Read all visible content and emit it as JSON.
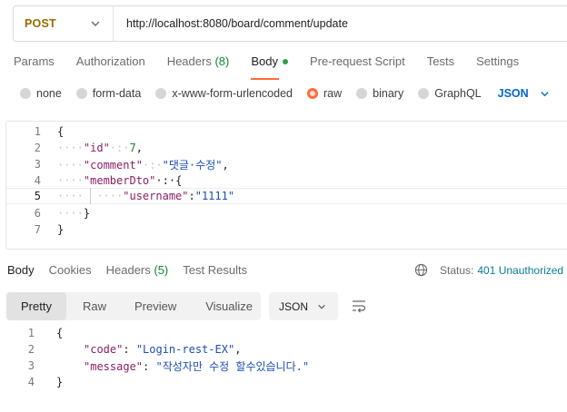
{
  "request": {
    "method": "POST",
    "url": "http://localhost:8080/board/comment/update"
  },
  "request_tabs": [
    {
      "label": "Params",
      "count": ""
    },
    {
      "label": "Authorization",
      "count": ""
    },
    {
      "label": "Headers",
      "count": "(8)"
    },
    {
      "label": "Body",
      "count": ""
    },
    {
      "label": "Pre-request Script",
      "count": ""
    },
    {
      "label": "Tests",
      "count": ""
    },
    {
      "label": "Settings",
      "count": ""
    }
  ],
  "body_types": [
    "none",
    "form-data",
    "x-www-form-urlencoded",
    "raw",
    "binary",
    "GraphQL"
  ],
  "body_language": "JSON",
  "request_body": {
    "line_numbers": [
      "1",
      "2",
      "3",
      "4",
      "5",
      "6",
      "7"
    ],
    "lines": [
      {
        "ws": "",
        "key": "",
        "rest": "{"
      },
      {
        "ws": "····",
        "key": "\"id\"",
        "rest": "·:·",
        "val": "7",
        "tail": ","
      },
      {
        "ws": "····",
        "key": "\"comment\"",
        "rest": "·:·",
        "val": "\"댓글·수정\"",
        "tail": ","
      },
      {
        "ws": "····",
        "key": "\"memberDto\"",
        "rest": "·:·{",
        "val": "",
        "tail": ""
      },
      {
        "ws": "····  ····",
        "key": "\"username\"",
        "rest": ":",
        "val": "\"1111\"",
        "tail": ""
      },
      {
        "ws": "····",
        "key": "",
        "rest": "}"
      },
      {
        "ws": "",
        "key": "",
        "rest": "}"
      }
    ]
  },
  "response_tabs": [
    {
      "label": "Body",
      "count": ""
    },
    {
      "label": "Cookies",
      "count": ""
    },
    {
      "label": "Headers",
      "count": "(5)"
    },
    {
      "label": "Test Results",
      "count": ""
    }
  ],
  "status": {
    "label": "Status:",
    "value": "401 Unauthorized"
  },
  "response_views": [
    "Pretty",
    "Raw",
    "Preview",
    "Visualize"
  ],
  "response_format": "JSON",
  "response_body": {
    "line_numbers": [
      "1",
      "2",
      "3",
      "4"
    ],
    "lines": [
      {
        "key": "",
        "rest": "{"
      },
      {
        "key": "\"code\"",
        "rest": ": ",
        "val": "\"Login-rest-EX\"",
        "tail": ","
      },
      {
        "key": "\"message\"",
        "rest": ": ",
        "val": "\"작성자만 수정 할수있습니다.\"",
        "tail": ""
      },
      {
        "key": "",
        "rest": "}"
      }
    ]
  },
  "colors": {
    "accent": "#ff6c37",
    "method": "#9a6a00",
    "status": "#0a7d96",
    "json_key": "#8a1f63",
    "json_string": "#1b4fb5"
  },
  "icons": [
    "chevron-down-icon",
    "globe-icon",
    "wrap-lines-icon"
  ]
}
